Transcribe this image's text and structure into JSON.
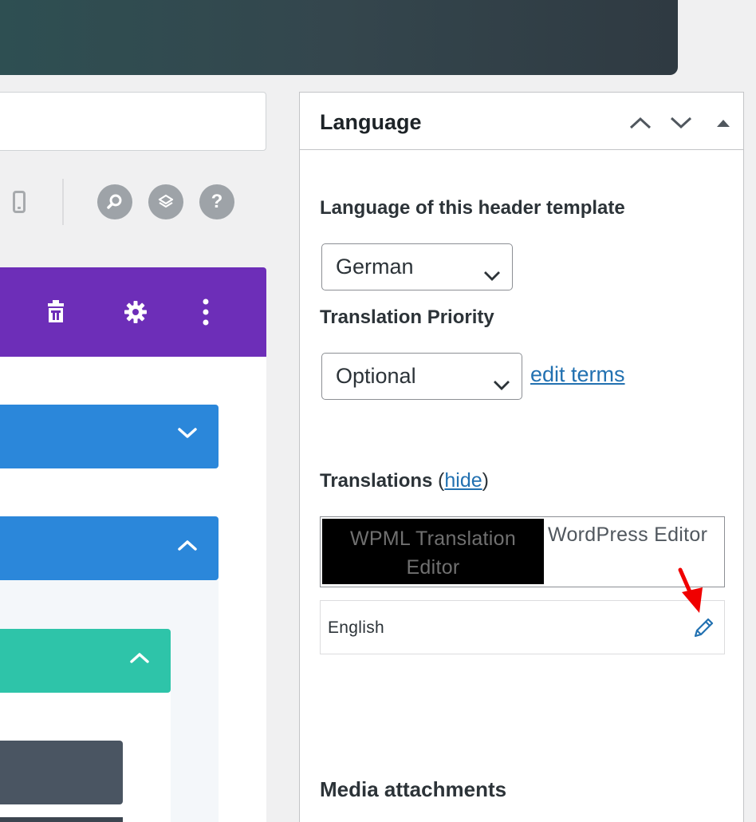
{
  "metabox": {
    "title": "Language",
    "language_label": "Language of this header template",
    "language_value": "German",
    "priority_label": "Translation Priority",
    "priority_value": "Optional",
    "edit_terms": "edit terms",
    "translations_label": "Translations",
    "hide_link": "hide",
    "paren_open": "(",
    "paren_close": ")",
    "tabs": {
      "wpml": "WPML Translation Editor",
      "wordpress": "WordPress Editor"
    },
    "translation_rows": [
      {
        "language": "English",
        "action_icon": "pencil-icon"
      }
    ],
    "media_label": "Media attachments"
  },
  "toolbar": {
    "icons": [
      "mobile-icon",
      "search-icon",
      "layers-icon",
      "help-icon"
    ],
    "help_glyph": "?"
  },
  "builder": {
    "row_actions": [
      "trash-icon",
      "gear-icon",
      "more-vertical-icon"
    ]
  },
  "colors": {
    "purple": "#6d2eb8",
    "blue": "#2b87da",
    "teal": "#2ec4a9",
    "slate": "#4a5562",
    "link": "#2271b1",
    "annotation_arrow": "#f00000"
  }
}
